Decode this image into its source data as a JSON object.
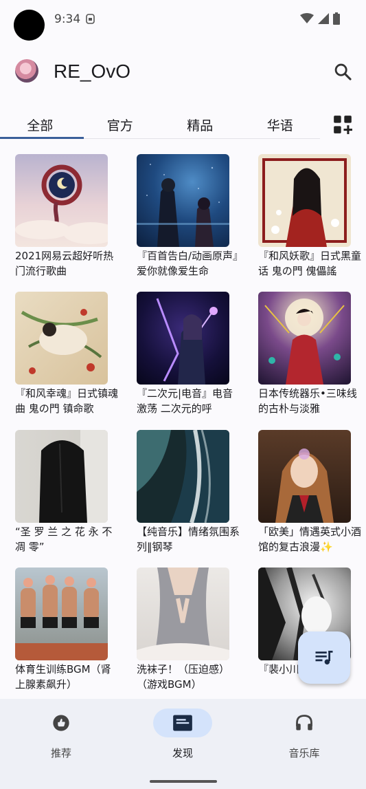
{
  "status_bar": {
    "time": "9:34"
  },
  "header": {
    "title": "RE_OvO"
  },
  "tabs": [
    {
      "label": "全部"
    },
    {
      "label": "官方"
    },
    {
      "label": "精品"
    },
    {
      "label": "华语"
    }
  ],
  "playlists": [
    {
      "title": "2021网易云超好听热门流行歌曲"
    },
    {
      "title": "『百首告白/动画原声』爱你就像爱生命"
    },
    {
      "title": "『和风妖歌』日式黑童话 鬼の門 傀儡謠"
    },
    {
      "title": "『和风幸魂』日式镇魂曲 鬼の門 镇命歌"
    },
    {
      "title": "『二次元|电音』电音激荡 二次元的呼"
    },
    {
      "title": "日本传统器乐•三味线的古朴与淡雅"
    },
    {
      "title": "“圣 罗 兰 之 花 永 不 凋 零”"
    },
    {
      "title": "【纯音乐】情绪氛围系列‖钢琴"
    },
    {
      "title": "「欧美」情遇英式小酒馆的复古浪漫✨"
    },
    {
      "title": "体育生训练BGM（肾上腺素飙升）"
    },
    {
      "title": "洗袜子！（压迫感）（游戏BGM）"
    },
    {
      "title": "『裴小川』大师』"
    }
  ],
  "bottom_nav": [
    {
      "label": "推荐"
    },
    {
      "label": "发现"
    },
    {
      "label": "音乐库"
    }
  ],
  "colors": {
    "accent": "#3a5f9a",
    "nav_active_bg": "#d4e3fb",
    "nav_bg": "#eef0f6"
  }
}
